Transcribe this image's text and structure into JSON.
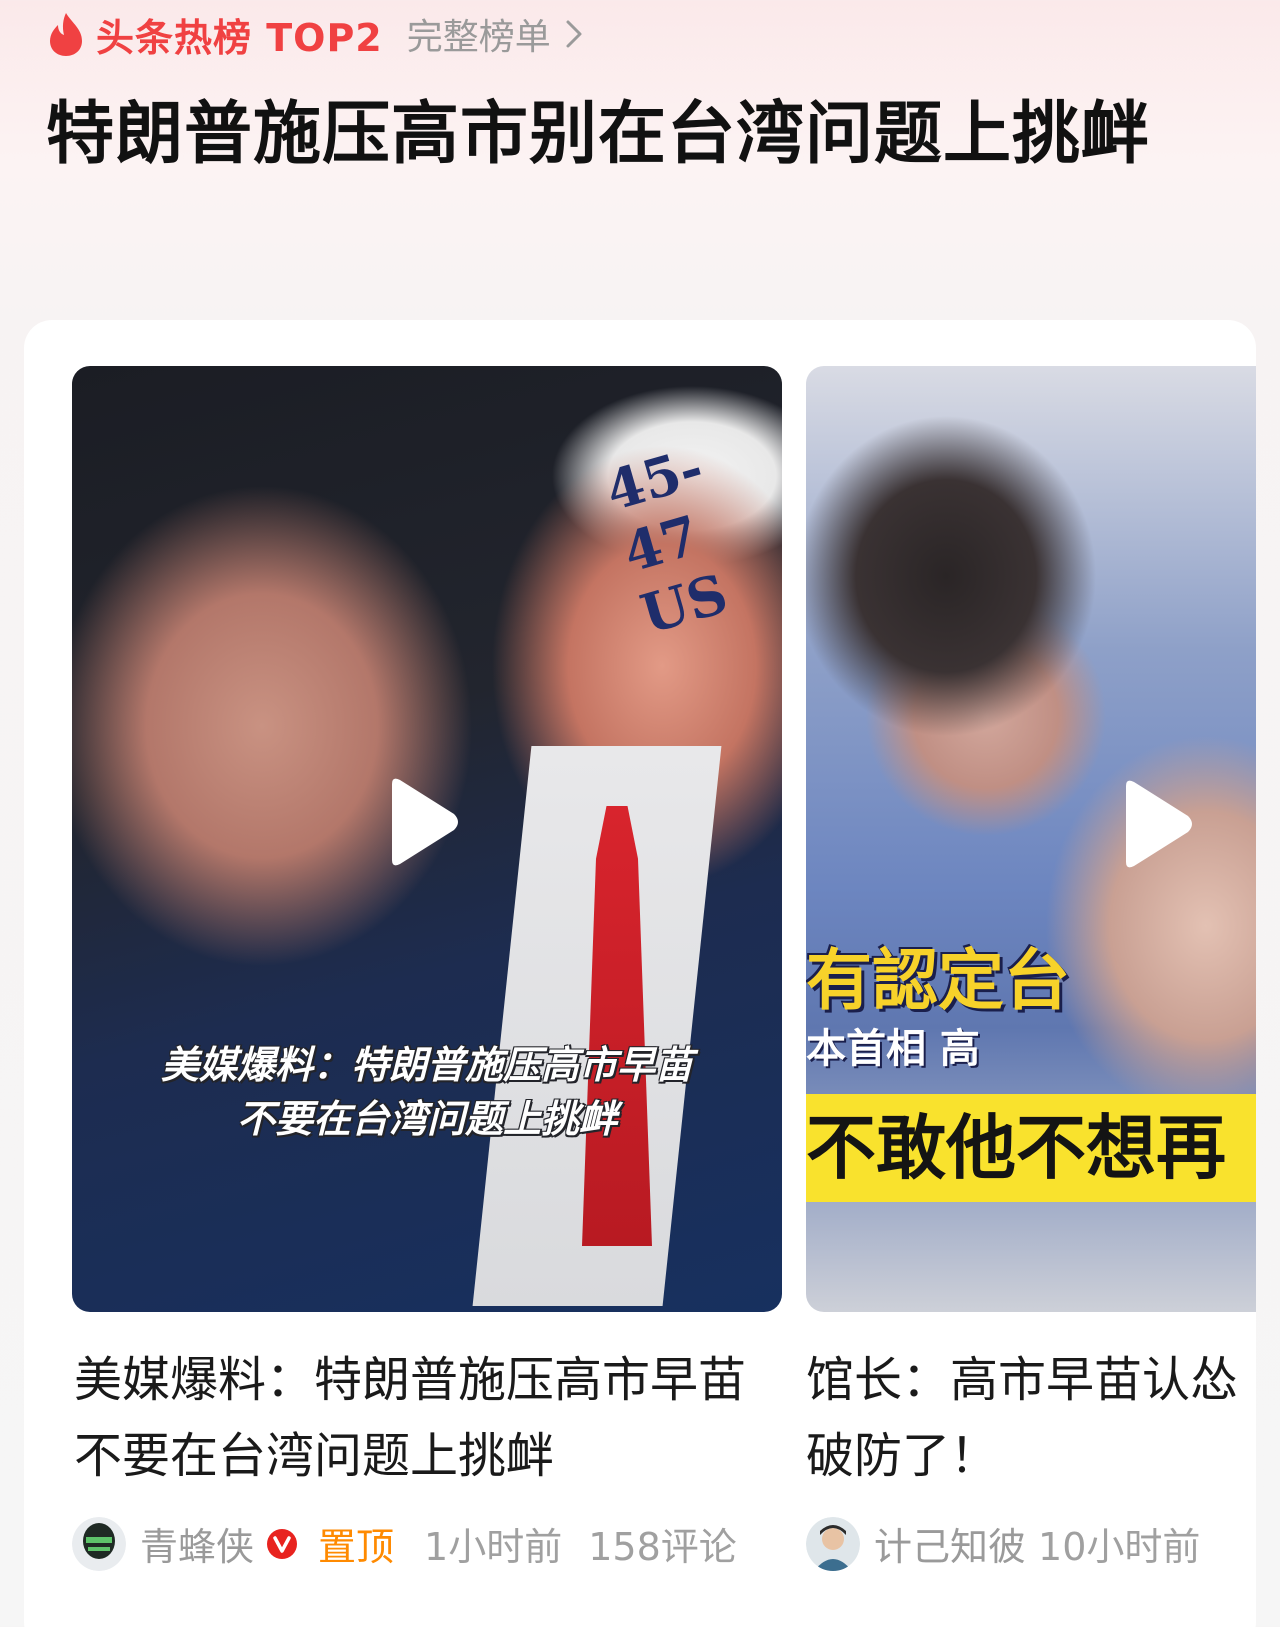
{
  "hot": {
    "badge": "头条热榜 TOP2",
    "full_list": "完整榜单",
    "title": "特朗普施压高市别在台湾问题上挑衅"
  },
  "cards": [
    {
      "overlay_lines": [
        "美媒爆料：特朗普施压高市早苗",
        "不要在台湾问题上挑衅"
      ],
      "cap_text": "45-47  US",
      "title": "美媒爆料：特朗普施压高市早苗不要在台湾问题上挑衅",
      "author": "青蜂侠",
      "pin": "置顶",
      "time": "1小时前",
      "comments": "158评论"
    },
    {
      "strip_a": "有認定台",
      "strip_b": "本首相 高",
      "strip_c": "不敢他不想再",
      "title": "馆长：高市早苗认怂破防了！",
      "author": "计己知彼",
      "time": "10小时前"
    }
  ],
  "colors": {
    "accent_red": "#f04142",
    "pin_orange": "#ff8a00",
    "meta_grey": "#a0a0a0"
  },
  "icons": [
    "flame-icon",
    "chevron-right-icon",
    "play-icon",
    "verified-badge-icon",
    "avatar"
  ]
}
